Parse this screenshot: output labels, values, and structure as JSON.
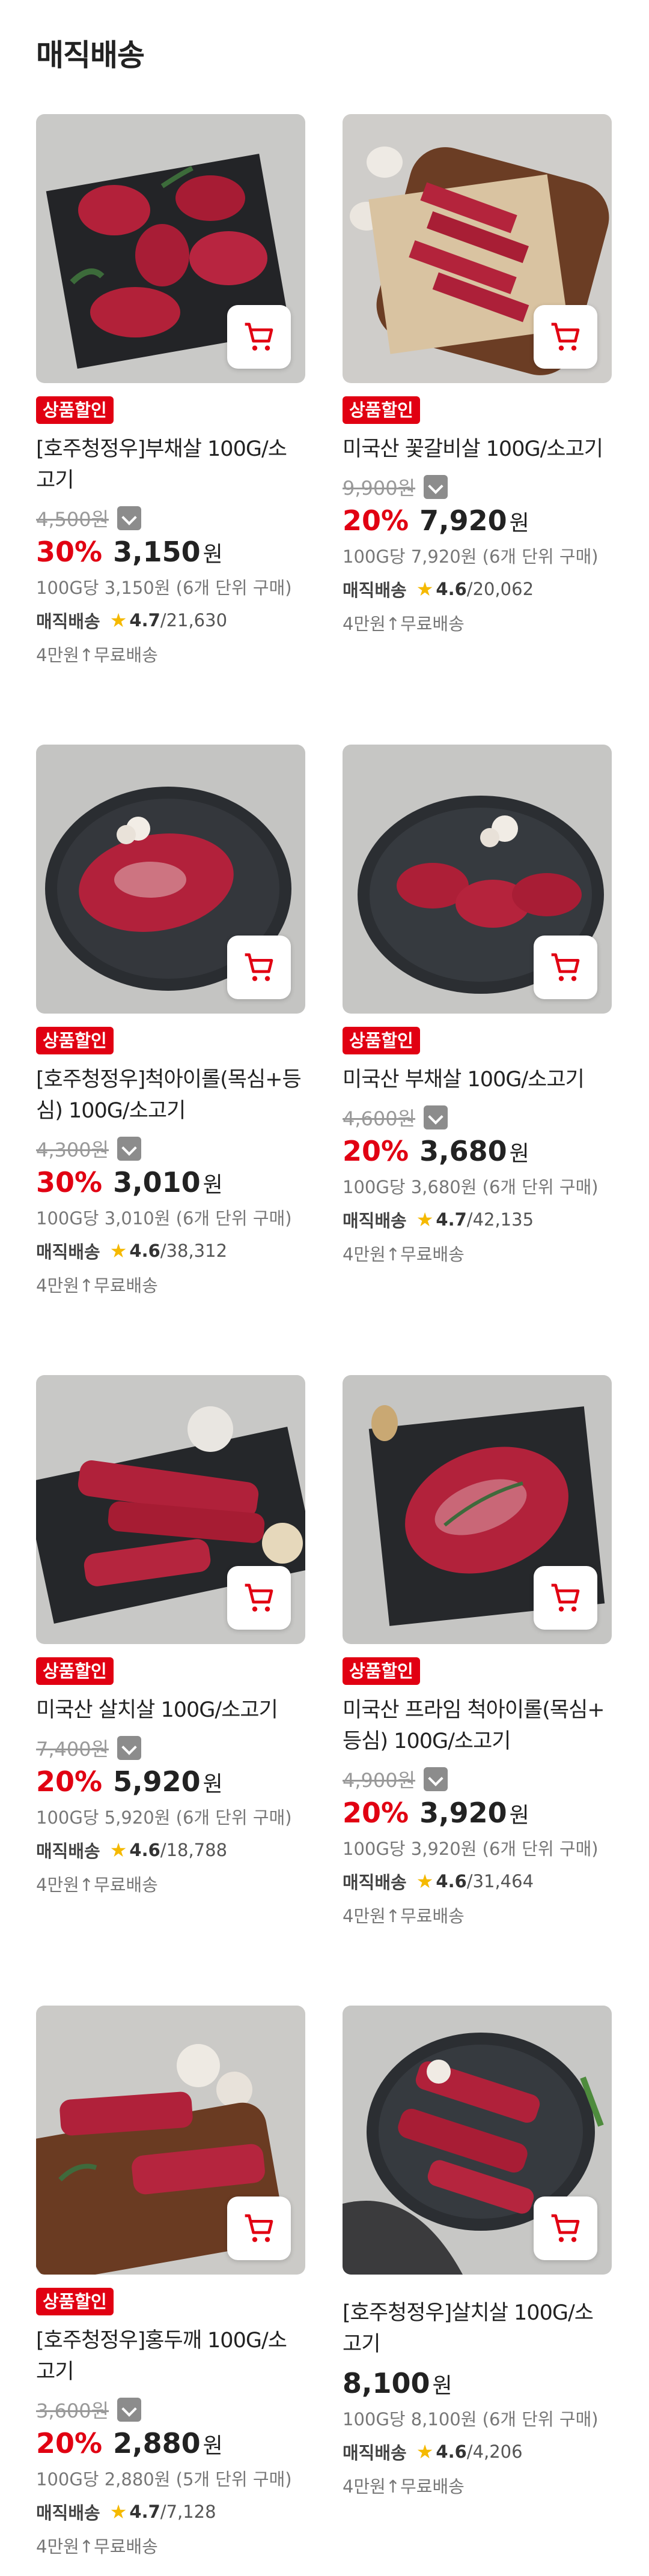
{
  "section_title": "매직배송",
  "cart_icon": "cart-icon",
  "colors": {
    "accent": "#e10012",
    "star": "#f5b900"
  },
  "products": [
    {
      "badge": "상품할인",
      "name_line1": "[호주청정우]부채살 100G/소",
      "name_line2": "고기",
      "orig_price": "4,500원",
      "discount": "30%",
      "price": "3,150",
      "won": "원",
      "unit_price": "100G당 3,150원 (6개 단위 구매)",
      "delivery": "매직배송",
      "score": "4.7",
      "reviews": "/21,630",
      "shipping": "4만원↑무료배송"
    },
    {
      "badge": "상품할인",
      "name_line1": "미국산 꽃갈비살 100G/소고기",
      "name_line2": "",
      "orig_price": "9,900원",
      "discount": "20%",
      "price": "7,920",
      "won": "원",
      "unit_price": "100G당 7,920원 (6개 단위 구매)",
      "delivery": "매직배송",
      "score": "4.6",
      "reviews": "/20,062",
      "shipping": "4만원↑무료배송"
    },
    {
      "badge": "상품할인",
      "name_line1": "[호주청정우]척아이롤(목심+등",
      "name_line2": "심) 100G/소고기",
      "orig_price": "4,300원",
      "discount": "30%",
      "price": "3,010",
      "won": "원",
      "unit_price": "100G당 3,010원 (6개 단위 구매)",
      "delivery": "매직배송",
      "score": "4.6",
      "reviews": "/38,312",
      "shipping": "4만원↑무료배송"
    },
    {
      "badge": "상품할인",
      "name_line1": "미국산 부채살 100G/소고기",
      "name_line2": "",
      "orig_price": "4,600원",
      "discount": "20%",
      "price": "3,680",
      "won": "원",
      "unit_price": "100G당 3,680원 (6개 단위 구매)",
      "delivery": "매직배송",
      "score": "4.7",
      "reviews": "/42,135",
      "shipping": "4만원↑무료배송"
    },
    {
      "badge": "상품할인",
      "name_line1": "미국산 살치살 100G/소고기",
      "name_line2": "",
      "orig_price": "7,400원",
      "discount": "20%",
      "price": "5,920",
      "won": "원",
      "unit_price": "100G당 5,920원 (6개 단위 구매)",
      "delivery": "매직배송",
      "score": "4.6",
      "reviews": "/18,788",
      "shipping": "4만원↑무료배송"
    },
    {
      "badge": "상품할인",
      "name_line1": "미국산 프라임 척아이롤(목심+",
      "name_line2": "등심) 100G/소고기",
      "orig_price": "4,900원",
      "discount": "20%",
      "price": "3,920",
      "won": "원",
      "unit_price": "100G당 3,920원 (6개 단위 구매)",
      "delivery": "매직배송",
      "score": "4.6",
      "reviews": "/31,464",
      "shipping": "4만원↑무료배송"
    },
    {
      "badge": "상품할인",
      "name_line1": "[호주청정우]홍두깨 100G/소",
      "name_line2": "고기",
      "orig_price": "3,600원",
      "discount": "20%",
      "price": "2,880",
      "won": "원",
      "unit_price": "100G당 2,880원 (5개 단위 구매)",
      "delivery": "매직배송",
      "score": "4.7",
      "reviews": "/7,128",
      "shipping": "4만원↑무료배송"
    },
    {
      "badge": "",
      "name_line1": "[호주청정우]살치살 100G/소",
      "name_line2": "고기",
      "orig_price": "",
      "discount": "",
      "price": "8,100",
      "won": "원",
      "unit_price": "100G당 8,100원 (6개 단위 구매)",
      "delivery": "매직배송",
      "score": "4.6",
      "reviews": "/4,206",
      "shipping": "4만원↑무료배송"
    }
  ]
}
